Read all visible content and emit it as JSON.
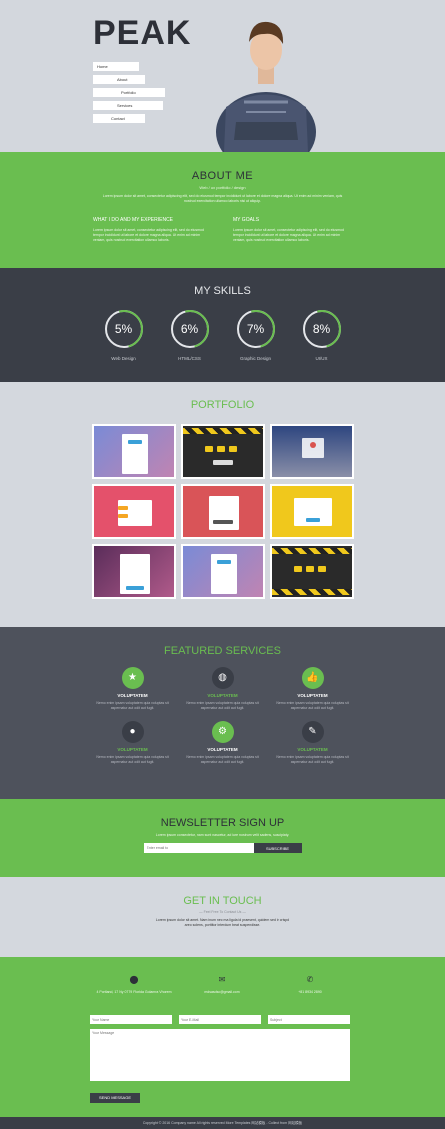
{
  "header": {
    "logo": "PEAK",
    "nav": [
      "Home",
      "About",
      "Portfolio",
      "Services",
      "Contact"
    ]
  },
  "about": {
    "title": "ABOUT ME",
    "subtitle": "Web / ux portfolio / design",
    "intro": "Lorem ipsum dolor sit amet, consectetur adipiscing elit, sed do eiusmod tempor incididunt ut labore et dolore magna aliqua. Ut enim ad minim veniam, quis nostrud exercitation ullamco laboris nisi ut aliquip.",
    "col1_title": "WHAT I DO AND MY EXPERIENCE",
    "col1_text": "Lorem ipsum dolor sit amet, consectetur adipiscing elit, sed do eiusmod tempor incididunt ut labore et dolore magna aliqua. Ut enim ad minim veniam, quis nostrud exercitation ullamco laboris.",
    "col2_title": "MY GOALS",
    "col2_text": "Lorem ipsum dolor sit amet, consectetur adipiscing elit, sed do eiusmod tempor incididunt ut labore et dolore magna aliqua. Ut enim ad minim veniam, quis nostrud exercitation ullamco laboris."
  },
  "skills": {
    "title": "MY SKILLS",
    "items": [
      {
        "value": "5%",
        "label": "Web Design"
      },
      {
        "value": "6%",
        "label": "HTML/CSS"
      },
      {
        "value": "7%",
        "label": "Graphic Design"
      },
      {
        "value": "8%",
        "label": "UI/UX"
      }
    ]
  },
  "portfolio": {
    "title": "PORTFOLIO"
  },
  "services": {
    "title": "FEATURED SERVICES",
    "items": [
      {
        "name": "VOLUPTATEM",
        "text": "Nemo enim ipsam voluptatem quia voluptas sit aspernatur aut odit aut fugit.",
        "icon": "star-icon"
      },
      {
        "name": "VOLUPTATEM",
        "text": "Nemo enim ipsam voluptatem quia voluptas sit aspernatur aut odit aut fugit.",
        "icon": "globe-icon"
      },
      {
        "name": "VOLUPTATEM",
        "text": "Nemo enim ipsam voluptatem quia voluptas sit aspernatur aut odit aut fugit.",
        "icon": "thumbs-up-icon"
      },
      {
        "name": "VOLUPTATEM",
        "text": "Nemo enim ipsam voluptatem quia voluptas sit aspernatur aut odit aut fugit.",
        "icon": "map-pin-icon"
      },
      {
        "name": "VOLUPTATEM",
        "text": "Nemo enim ipsam voluptatem quia voluptas sit aspernatur aut odit aut fugit.",
        "icon": "gear-icon"
      },
      {
        "name": "VOLUPTATEM",
        "text": "Nemo enim ipsam voluptatem quia voluptas sit aspernatur aut odit aut fugit.",
        "icon": "pencil-icon"
      }
    ]
  },
  "newsletter": {
    "title": "NEWSLETTER SIGN UP",
    "desc": "Lorem ipsum consectetur, nam sunt nascetur, ad iure nostrum velit sadens, suscipiaty.",
    "placeholder": "Enter email to",
    "button": "SUBSCRIBE"
  },
  "touch": {
    "title": "GET IN TOUCH",
    "sub": "— Feel Free To Contact Us —",
    "desc": "Lorem ipsum dolor sit amet. Nam inum nec ma ligula id praesent, quidem sed ir crispd areo solens, porttitor interdum beat suspendisse."
  },
  "contact": {
    "address": "4 Portland, 17 Ny 0779 Florida Golamra Vhorem",
    "email": "mdsasdsc@gmail.com",
    "phone": "+81 8934 2890",
    "name_ph": "Your Name",
    "email_ph": "Your E-Mail",
    "subject_ph": "Subject",
    "message_ph": "Your Message",
    "button": "SEND MESSAGE"
  },
  "footer": {
    "text": "Copyright © 2016 Company name All rights reserved More Templates 网站模板 - Collect from 网站模板"
  }
}
